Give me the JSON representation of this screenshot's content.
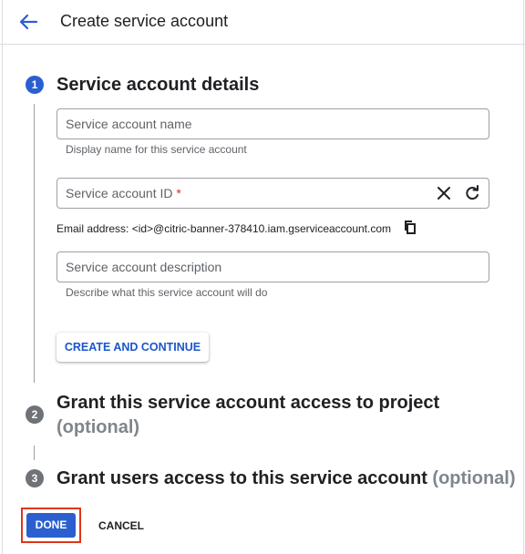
{
  "header": {
    "title": "Create service account",
    "back_icon": "arrow-back-icon"
  },
  "colors": {
    "accent": "#2b5fd0",
    "link": "#1a56c9",
    "required": "#d93025",
    "highlight_border": "#e0351b",
    "inactive_step": "#6f7377"
  },
  "steps": [
    {
      "number": "1",
      "title": "Service account details",
      "status": "active"
    },
    {
      "number": "2",
      "title": "Grant this service account access to project",
      "optional_label": "(optional)",
      "status": "inactive"
    },
    {
      "number": "3",
      "title": "Grant users access to this service account",
      "optional_label": "(optional)",
      "status": "inactive"
    }
  ],
  "form": {
    "name": {
      "placeholder": "Service account name",
      "value": "",
      "helper": "Display name for this service account"
    },
    "id": {
      "placeholder": "Service account ID",
      "required_mark": "*",
      "value": "",
      "clear_icon": "close-icon",
      "refresh_icon": "refresh-icon"
    },
    "email": {
      "text": "Email address: <id>@citric-banner-378410.iam.gserviceaccount.com",
      "copy_icon": "copy-icon"
    },
    "description": {
      "placeholder": "Service account description",
      "value": "",
      "helper": "Describe what this service account will do"
    },
    "create_button": "CREATE AND CONTINUE"
  },
  "footer": {
    "done_button": "DONE",
    "cancel_button": "CANCEL"
  }
}
